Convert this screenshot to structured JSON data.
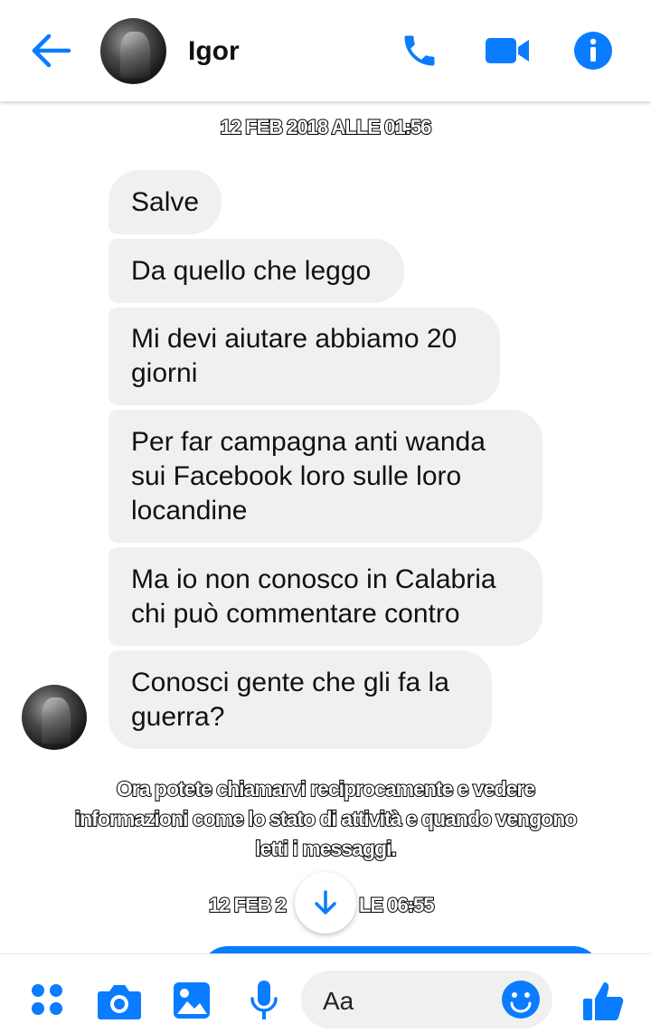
{
  "header": {
    "contact_name": "Igor",
    "icons": [
      "back-arrow-icon",
      "phone-icon",
      "video-camera-icon",
      "info-icon"
    ]
  },
  "conversation": {
    "timestamp_top": "12 FEB 2018 ALLE 01:56",
    "messages": [
      {
        "text": "Salve"
      },
      {
        "text": "Da quello che leggo"
      },
      {
        "text": "Mi devi aiutare abbiamo 20\ngiorni"
      },
      {
        "text": "Per far campagna anti wanda\nsui Facebook loro sulle loro\nlocandine"
      },
      {
        "text": "Ma io non conosco in Calabria\nchi può commentare contro"
      },
      {
        "text": "Conosci gente che gli fa la\nguerra?"
      }
    ],
    "notice": "Ora potete chiamarvi reciprocamente e vedere informazioni come lo stato di attività e quando vengono letti i messaggi.",
    "timestamp_bottom_left": "12 FEB 2",
    "timestamp_bottom_right": "LE 06:55"
  },
  "composer": {
    "placeholder": "Aa",
    "icons": [
      "menu-dots-icon",
      "camera-icon",
      "gallery-icon",
      "microphone-icon",
      "emoji-icon",
      "like-icon"
    ]
  },
  "colors": {
    "accent": "#0a7cff",
    "bubble_incoming": "#f0f0f0"
  }
}
